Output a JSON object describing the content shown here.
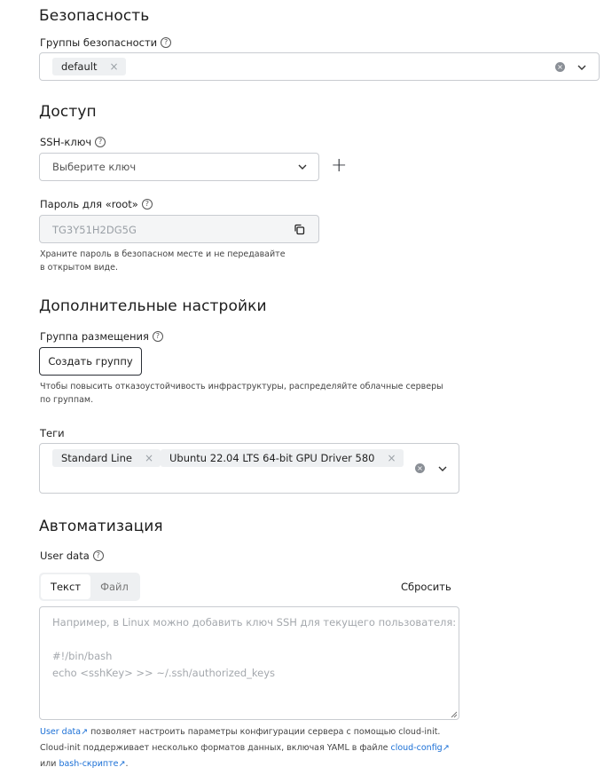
{
  "security": {
    "title": "Безопасность",
    "groups_label": "Группы безопасности",
    "groups_tags": [
      "default"
    ]
  },
  "access": {
    "title": "Доступ",
    "ssh_label": "SSH-ключ",
    "ssh_placeholder": "Выберите ключ",
    "root_label": "Пароль для «root»",
    "root_password": "TG3Y51H2DG5G",
    "root_hint_line1": "Храните пароль в безопасном месте и не передавайте",
    "root_hint_line2": "в открытом виде."
  },
  "advanced": {
    "title": "Дополнительные настройки",
    "placement_label": "Группа размещения",
    "create_group_button": "Создать группу",
    "placement_hint_line1": "Чтобы повысить отказоустойчивость инфраструктуры, распределяйте облачные серверы",
    "placement_hint_line2": "по группам.",
    "tags_label": "Теги",
    "tags": [
      "Standard Line",
      "Ubuntu 22.04 LTS 64-bit GPU Driver 580"
    ]
  },
  "automation": {
    "title": "Автоматизация",
    "user_data_label": "User data",
    "tab_text": "Текст",
    "tab_file": "Файл",
    "reset_button": "Сбросить",
    "placeholder_line1": "Например, в Linux можно добавить ключ SSH для текущего пользователя:",
    "placeholder_line2": "#!/bin/bash",
    "placeholder_line3": "echo <sshKey> >> ~/.ssh/authorized_keys",
    "footer_link_user_data": "User data",
    "footer_text1": " позволяет настроить параметры конфигурации сервера с помощью cloud-init.",
    "footer_text2": "Cloud-init поддерживает несколько форматов данных, включая YAML в файле ",
    "footer_link_cloud_config": "cloud-config",
    "footer_text3": "или ",
    "footer_link_bash": "bash-скрипте",
    "footer_text4": "."
  },
  "icons": {
    "help": "?",
    "clear": "×",
    "remove_tag": "×",
    "add": "+",
    "external": "↗"
  },
  "colors": {
    "link": "#1a6fd6",
    "border": "#c9ccd1",
    "tag_bg": "#eef0f2"
  }
}
